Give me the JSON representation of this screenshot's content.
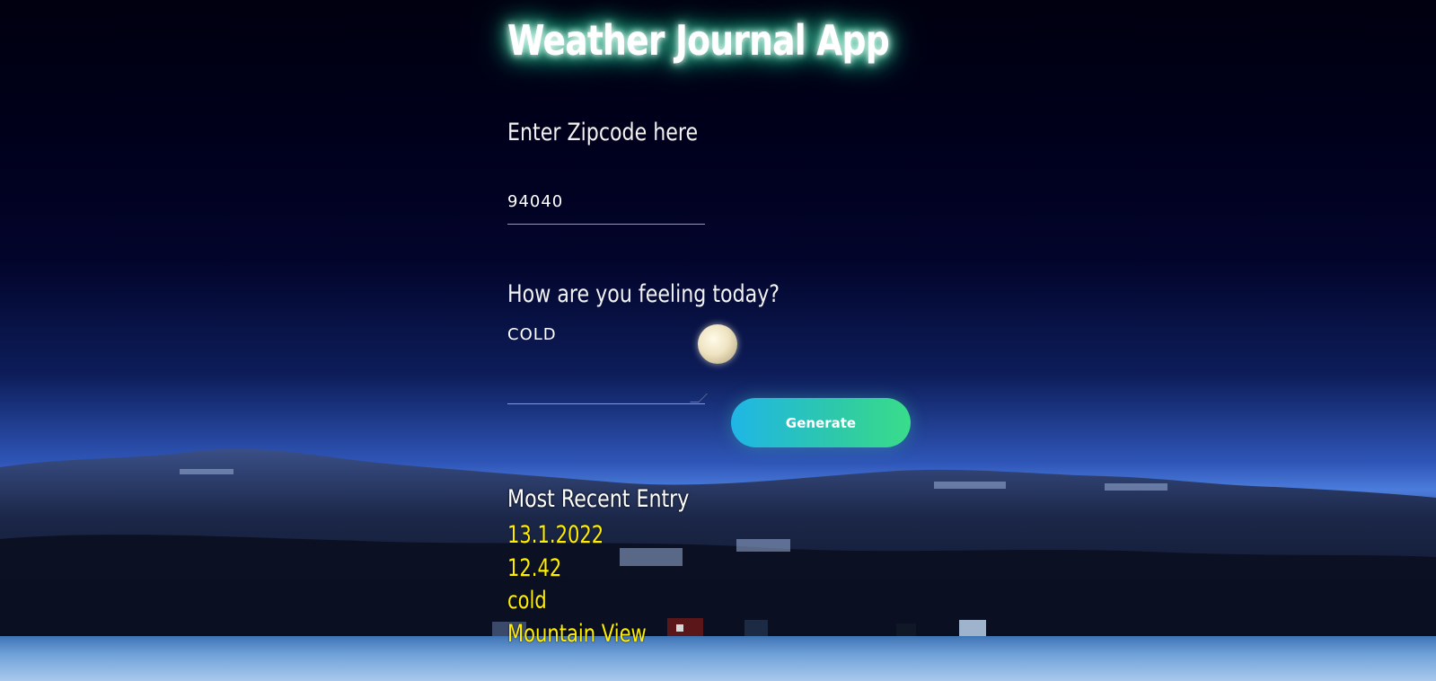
{
  "app": {
    "title": "Weather Journal App"
  },
  "zip": {
    "label": "Enter Zipcode here",
    "value": "94040"
  },
  "feelings": {
    "label": "How are you feeling today?",
    "value": "COLD"
  },
  "generate": {
    "label": "Generate"
  },
  "entry": {
    "title": "Most Recent Entry",
    "date": "13.1.2022",
    "temp": "12.42",
    "content": "cold",
    "city": "Mountain View"
  },
  "colors": {
    "title_glow": "#2fe0a0",
    "entry_text": "#ffee00",
    "button_start": "#1fb6e6",
    "button_end": "#39dd8a"
  }
}
